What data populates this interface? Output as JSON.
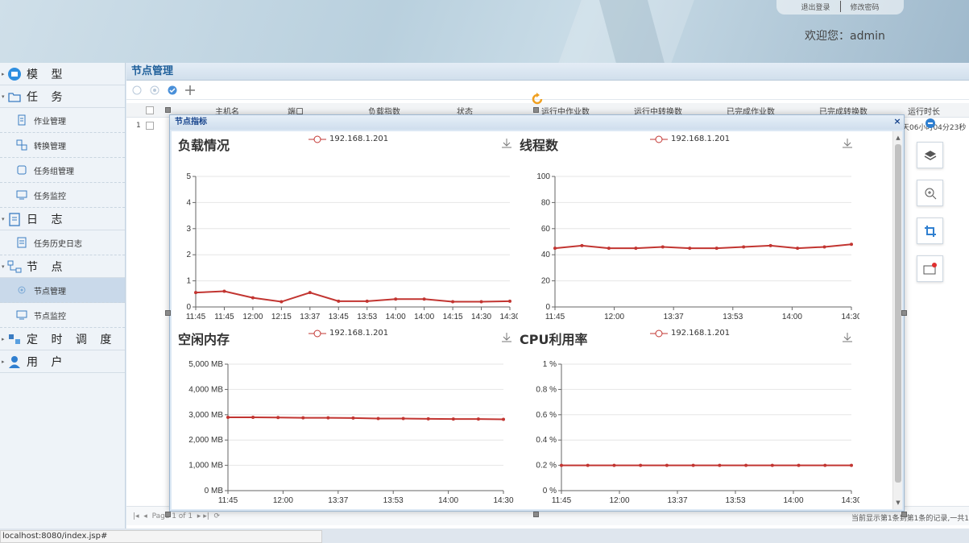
{
  "header": {
    "logout_label": "退出登录",
    "change_password_label": "修改密码",
    "welcome_text": "欢迎您：admin"
  },
  "sidebar": {
    "groups": [
      {
        "label": "模 型"
      },
      {
        "label": "任 务",
        "items": [
          {
            "label": "作业管理"
          },
          {
            "label": "转换管理"
          },
          {
            "label": "任务组管理"
          },
          {
            "label": "任务监控"
          }
        ]
      },
      {
        "label": "日 志",
        "items": [
          {
            "label": "任务历史日志"
          }
        ]
      },
      {
        "label": "节 点",
        "items": [
          {
            "label": "节点管理"
          },
          {
            "label": "节点监控"
          }
        ]
      },
      {
        "label": "定 时 调 度"
      },
      {
        "label": "用 户"
      }
    ]
  },
  "main": {
    "title": "节点管理",
    "columns": [
      "主机名",
      "端口",
      "负载指数",
      "状态",
      "运行中作业数",
      "运行中转换数",
      "已完成作业数",
      "已完成转换数",
      "运行时长"
    ],
    "row_number": "1",
    "row_runtime": "天06小时04分23秒",
    "pager_left": "Page 1 of 1",
    "pager_right": "当前显示第1条到第1条的记录,一共1"
  },
  "dialog": {
    "title": "节点指标",
    "close_glyph": "×"
  },
  "status_url": "localhost:8080/index.jsp#",
  "colors": {
    "series": "#c23531",
    "accent": "#1f5f9a"
  },
  "chart_data": [
    {
      "type": "line",
      "title": "负载情况",
      "legend": [
        "192.168.1.201"
      ],
      "x": [
        "11:45",
        "11:45",
        "12:00",
        "12:15",
        "13:37",
        "13:45",
        "13:53",
        "14:00",
        "14:00",
        "14:15",
        "14:30",
        "14:30"
      ],
      "series": [
        {
          "name": "192.168.1.201",
          "values": [
            0.55,
            0.6,
            0.35,
            0.2,
            0.55,
            0.22,
            0.22,
            0.3,
            0.3,
            0.2,
            0.2,
            0.22
          ]
        }
      ],
      "ylim": [
        0,
        5
      ],
      "yticks": [
        "0",
        "1",
        "2",
        "3",
        "4",
        "5"
      ],
      "xticks": [
        "11:45",
        "11:45",
        "12:00",
        "12:15",
        "13:37",
        "13:45",
        "13:53",
        "14:00",
        "14:00",
        "14:15",
        "14:30",
        "14:30"
      ],
      "grid": true
    },
    {
      "type": "line",
      "title": "线程数",
      "legend": [
        "192.168.1.201"
      ],
      "x": [
        "11:45",
        "11:45",
        "12:00",
        "12:15",
        "13:37",
        "13:45",
        "13:53",
        "14:00",
        "14:00",
        "14:15",
        "14:30",
        "14:30"
      ],
      "series": [
        {
          "name": "192.168.1.201",
          "values": [
            45,
            47,
            45,
            45,
            46,
            45,
            45,
            46,
            47,
            45,
            46,
            48
          ]
        }
      ],
      "ylim": [
        0,
        100
      ],
      "yticks": [
        "0",
        "20",
        "40",
        "60",
        "80",
        "100"
      ],
      "xticks": [
        "11:45",
        "12:00",
        "13:37",
        "13:53",
        "14:00",
        "14:30"
      ],
      "grid": true
    },
    {
      "type": "line",
      "title": "空闲内存",
      "legend": [
        "192.168.1.201"
      ],
      "x": [
        "11:45",
        "11:45",
        "12:00",
        "12:15",
        "13:37",
        "13:45",
        "13:53",
        "14:00",
        "14:00",
        "14:15",
        "14:30",
        "14:30"
      ],
      "series": [
        {
          "name": "192.168.1.201",
          "values": [
            2900,
            2900,
            2890,
            2880,
            2880,
            2870,
            2850,
            2850,
            2840,
            2830,
            2830,
            2820
          ]
        }
      ],
      "ylim": [
        0,
        5000
      ],
      "yticks": [
        "0 MB",
        "1,000 MB",
        "2,000 MB",
        "3,000 MB",
        "4,000 MB",
        "5,000 MB"
      ],
      "xticks": [
        "11:45",
        "12:00",
        "13:37",
        "13:53",
        "14:00",
        "14:30"
      ],
      "grid": true
    },
    {
      "type": "line",
      "title": "CPU利用率",
      "legend": [
        "192.168.1.201"
      ],
      "x": [
        "11:45",
        "11:45",
        "12:00",
        "12:15",
        "13:37",
        "13:45",
        "13:53",
        "14:00",
        "14:00",
        "14:15",
        "14:30",
        "14:30"
      ],
      "series": [
        {
          "name": "192.168.1.201",
          "values": [
            0.2,
            0.2,
            0.2,
            0.2,
            0.2,
            0.2,
            0.2,
            0.2,
            0.2,
            0.2,
            0.2,
            0.2
          ]
        }
      ],
      "ylim": [
        0,
        1
      ],
      "yticks": [
        "0 %",
        "0.2 %",
        "0.4 %",
        "0.6 %",
        "0.8 %",
        "1 %"
      ],
      "xticks": [
        "11:45",
        "12:00",
        "13:37",
        "13:53",
        "14:00",
        "14:30"
      ],
      "grid": true
    }
  ]
}
